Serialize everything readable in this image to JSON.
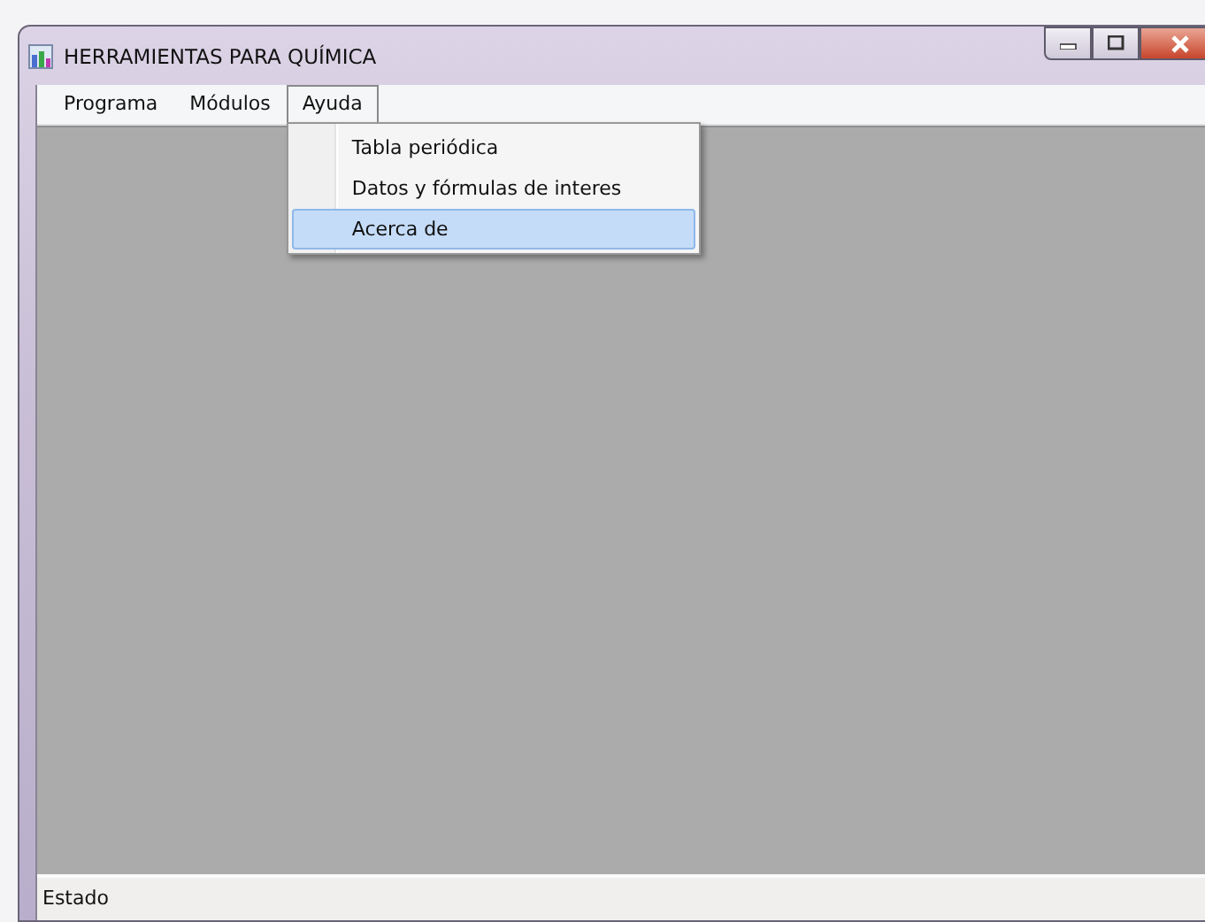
{
  "window": {
    "title": "HERRAMIENTAS PARA QUÍMICA"
  },
  "menu": [
    {
      "label": "Programa",
      "selected": false
    },
    {
      "label": "Módulos",
      "selected": false
    },
    {
      "label": "Ayuda",
      "selected": true,
      "items": [
        {
          "label": "Tabla periódica",
          "selected": false
        },
        {
          "label": "Datos y fórmulas de interes",
          "selected": false
        },
        {
          "label": "Acerca de",
          "selected": true
        }
      ]
    }
  ],
  "status_bar": {
    "text": "Estado"
  }
}
